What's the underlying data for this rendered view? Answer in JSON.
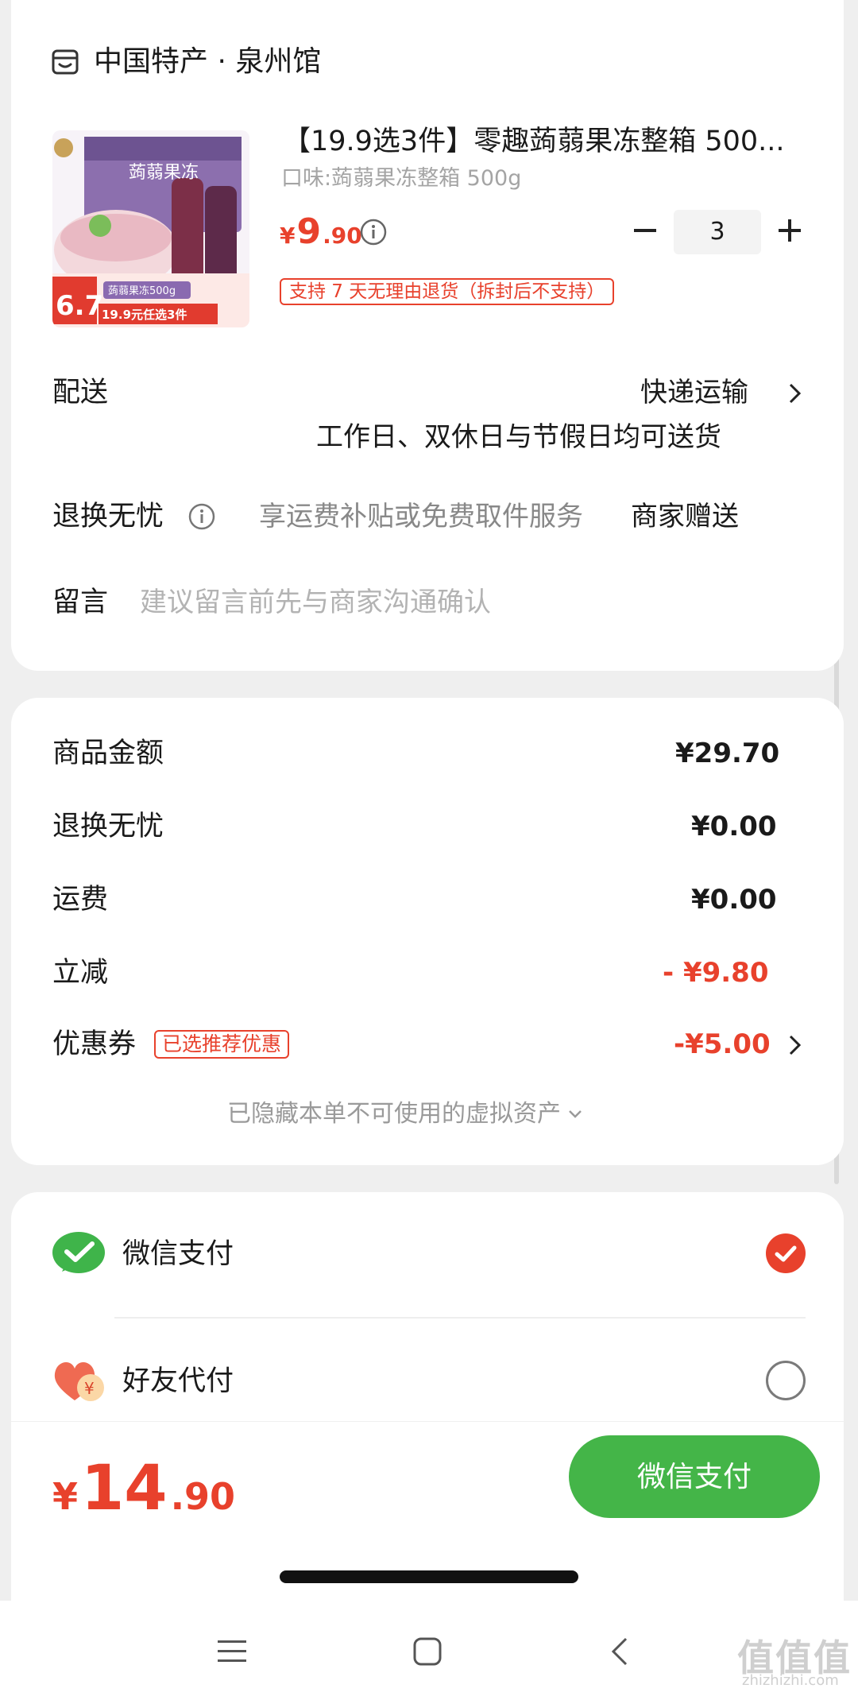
{
  "store": {
    "name": "中国特产 · 泉州馆",
    "icon": "store-icon"
  },
  "product": {
    "title": "【19.9选3件】零趣蒟蒻果冻整箱 500...",
    "spec": "口味:蒟蒻果冻整箱 500g",
    "price_currency": "¥",
    "price_int": "9",
    "price_dec": ".90",
    "quantity": "3",
    "return_tag": "支持 7 天无理由退货（拆封后不支持）",
    "image_texts": {
      "badge_price": "6.7",
      "promo": "19.9元任选3件",
      "box_label": "蒟蒻果冻500g",
      "packaging": "蒟蒻果冻"
    }
  },
  "delivery": {
    "label": "配送",
    "value": "快递运输",
    "note": "工作日、双休日与节假日均可送货"
  },
  "worry_free": {
    "label": "退换无忧",
    "desc": "享运费补贴或免费取件服务",
    "value": "商家赠送"
  },
  "message": {
    "label": "留言",
    "placeholder": "建议留言前先与商家沟通确认"
  },
  "summary": {
    "goods_label": "商品金额",
    "goods_value": "¥29.70",
    "worry_label": "退换无忧",
    "worry_value": "¥0.00",
    "shipping_label": "运费",
    "shipping_value": "¥0.00",
    "discount_label": "立减",
    "discount_value": "- ¥9.80",
    "coupon_label": "优惠券",
    "coupon_tag": "已选推荐优惠",
    "coupon_value": "-¥5.00",
    "hidden_assets": "已隐藏本单不可使用的虚拟资产"
  },
  "payment": {
    "wechat_label": "微信支付",
    "friend_label": "好友代付",
    "selected": "wechat"
  },
  "bottom": {
    "total_currency": "¥",
    "total_int": "14",
    "total_dec": ".90",
    "pay_button": "微信支付"
  },
  "watermark": {
    "text": "值值值",
    "sub": "zhizhizhi.com"
  },
  "colors": {
    "accent_red": "#e8412c",
    "wechat_green": "#44b548",
    "background": "#efefef"
  }
}
